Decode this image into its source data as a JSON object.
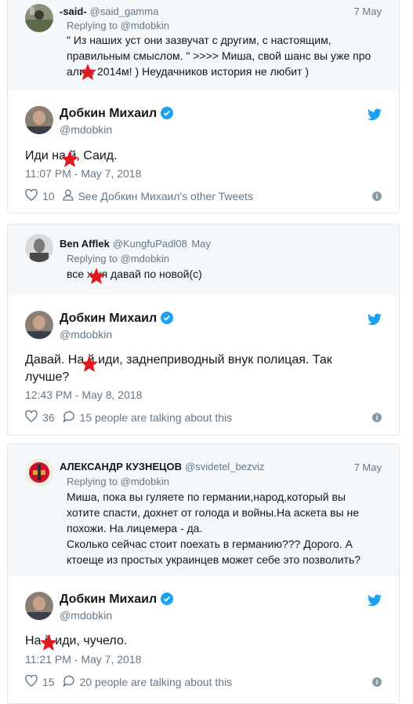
{
  "accent": "#1da1f2",
  "muted": "#657786",
  "star_color": "#e0191f",
  "main_author": {
    "name": "Добкин Михаил",
    "handle": "@mdobkin"
  },
  "tweets": [
    {
      "reply": {
        "name": "-said-",
        "handle": "@said_gamma",
        "date": "7 May",
        "replying": "Replying to @mdobkin",
        "text": "\" Из наших уст они зазвучат с другим, с настоящим, правильным смыслом. \" >>>> Миша, свой шанс вы уже про    али в 2014м! ) Неудачников история не любит )"
      },
      "main": {
        "text": "Иди на    й, Саид.",
        "time": "11:07 PM - May 7, 2018",
        "likes": "10",
        "action_text": "See Добкин Михаил's other Tweets",
        "action_icon": "person-icon"
      }
    },
    {
      "reply": {
        "name": "Ben Afflek",
        "handle": "@KungfuPadl08",
        "date": "May",
        "replying": "Replying to @mdobkin",
        "text": "все х    ня давай по новой(с)"
      },
      "main": {
        "text": "Давай. На    й иди, заднеприводный внук полицая. Так лучше?",
        "time": "12:43 PM - May 8, 2018",
        "likes": "36",
        "action_text": "15 people are talking about this",
        "action_icon": "speech-bubble-icon"
      }
    },
    {
      "reply": {
        "name": "АЛЕКСАНДР КУЗНЕЦОВ",
        "handle": "@svidetel_bezviz",
        "date": "7 May",
        "replying": "Replying to @mdobkin",
        "text": "Миша, пока вы гуляете по германии,народ,который вы хотите спасти, дохнет от голода и войны.На аскета вы не похожи. На лицемера - да.\nСколько сейчас стоит поехать в германию??? Дорого. А ктоеще из простых украинцев может себе это позволить?"
      },
      "main": {
        "text": "На    й иди, чучело.",
        "time": "11:21 PM - May 7, 2018",
        "likes": "15",
        "action_text": "20 people are talking about this",
        "action_icon": "speech-bubble-icon"
      }
    }
  ]
}
